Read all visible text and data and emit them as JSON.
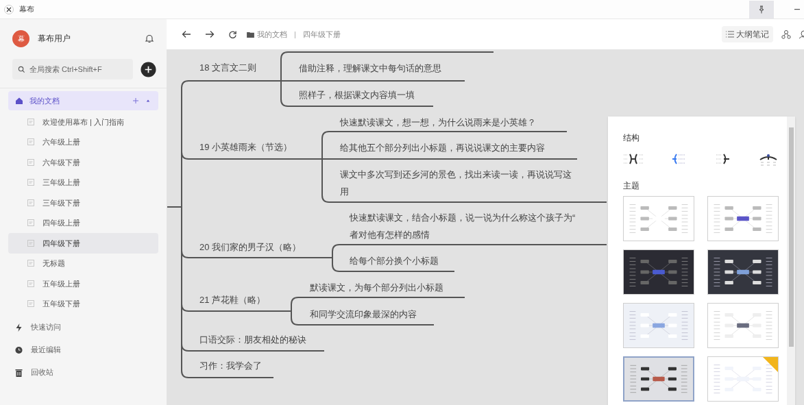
{
  "window": {
    "title": "幕布"
  },
  "sidebar": {
    "user": {
      "avatar_text": "幕",
      "name": "幕布用户"
    },
    "search": {
      "placeholder": "全局搜索 Ctrl+Shift+F"
    },
    "folder": {
      "label": "我的文档",
      "expanded": true
    },
    "documents": [
      {
        "label": "欢迎使用幕布 | 入门指南",
        "selected": false
      },
      {
        "label": "六年级上册",
        "selected": false
      },
      {
        "label": "六年级下册",
        "selected": false
      },
      {
        "label": "三年级上册",
        "selected": false
      },
      {
        "label": "三年级下册",
        "selected": false
      },
      {
        "label": "四年级上册",
        "selected": false
      },
      {
        "label": "四年级下册",
        "selected": true
      },
      {
        "label": "无标题",
        "selected": false
      },
      {
        "label": "五年级上册",
        "selected": false
      },
      {
        "label": "五年级下册",
        "selected": false
      }
    ],
    "nav": [
      {
        "kind": "quick",
        "label": "快速访问"
      },
      {
        "kind": "recent",
        "label": "最近编辑"
      },
      {
        "kind": "trash",
        "label": "回收站"
      }
    ]
  },
  "header": {
    "breadcrumb": [
      "我的文档",
      "四年级下册"
    ],
    "separator": "|",
    "outline_button": "大纲笔记"
  },
  "mindmap": {
    "topics": [
      {
        "title": "18 文言文二则",
        "children": [
          {
            "lines": [
              "借助注释，理解课文中每句话的意思"
            ]
          },
          {
            "lines": [
              "照样子，根据课文内容填一填"
            ]
          }
        ]
      },
      {
        "title": "19 小英雄雨来（节选）",
        "children": [
          {
            "lines": [
              "快速默读课文，想一想，为什么说雨来是小英雄？"
            ]
          },
          {
            "lines": [
              "给其他五个部分列出小标题，再说说课文的主要内容"
            ]
          },
          {
            "lines": [
              "课文中多次写到还乡河的景色，找出来读一读，再说说写这",
              "用"
            ]
          }
        ]
      },
      {
        "title": "20 我们家的男子汉（略）",
        "children": [
          {
            "lines": [
              "快速默读课文，结合小标题，说一说为什么称这个孩子为“",
              "者对他有怎样的感情"
            ]
          },
          {
            "lines": [
              "给每个部分换个小标题"
            ]
          }
        ]
      },
      {
        "title": "21 芦花鞋（略）",
        "children": [
          {
            "lines": [
              "默读课文，为每个部分列出小标题"
            ]
          },
          {
            "lines": [
              "和同学交流印象最深的内容"
            ]
          }
        ]
      },
      {
        "title": "口语交际：朋友相处的秘诀"
      },
      {
        "title": "习作：我学会了"
      }
    ]
  },
  "style_panel": {
    "structure_title": "结构",
    "structures": [
      {
        "kind": "both",
        "selected": false
      },
      {
        "kind": "left",
        "selected": true
      },
      {
        "kind": "right",
        "selected": false
      },
      {
        "kind": "org",
        "selected": false
      }
    ],
    "theme_title": "主题",
    "themes": [
      {
        "kind": "white",
        "selected": false,
        "premium": false
      },
      {
        "kind": "white-purple",
        "selected": false,
        "premium": false
      },
      {
        "kind": "dark",
        "selected": false,
        "premium": false
      },
      {
        "kind": "dark-blue",
        "selected": false,
        "premium": false
      },
      {
        "kind": "pale-blue",
        "selected": false,
        "premium": false
      },
      {
        "kind": "white-gray",
        "selected": false,
        "premium": false
      },
      {
        "kind": "gray-red",
        "selected": true,
        "premium": false
      },
      {
        "kind": "white-light",
        "selected": false,
        "premium": true
      }
    ]
  }
}
